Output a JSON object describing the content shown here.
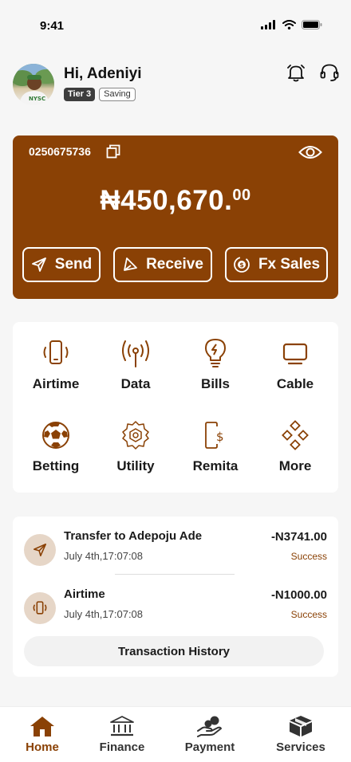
{
  "status_bar": {
    "time": "9:41"
  },
  "header": {
    "greeting": "Hi, Adeniyi",
    "tier_badge": "Tier 3",
    "account_type_badge": "Saving"
  },
  "balance_card": {
    "account_number": "0250675736",
    "balance_main": "₦450,670.",
    "balance_kobo": "00",
    "buttons": {
      "send": "Send",
      "receive": "Receive",
      "fx_sales": "Fx Sales"
    }
  },
  "services": [
    {
      "label": "Airtime",
      "icon": "phone-signal-icon"
    },
    {
      "label": "Data",
      "icon": "antenna-icon"
    },
    {
      "label": "Bills",
      "icon": "lightbulb-bolt-icon"
    },
    {
      "label": "Cable",
      "icon": "tv-icon"
    },
    {
      "label": "Betting",
      "icon": "soccer-ball-icon"
    },
    {
      "label": "Utility",
      "icon": "gear-hexagon-icon"
    },
    {
      "label": "Remita",
      "icon": "phone-dollar-icon"
    },
    {
      "label": "More",
      "icon": "diamonds-grid-icon"
    }
  ],
  "transactions": {
    "items": [
      {
        "title": "Transfer to Adepoju Ade",
        "date": "July 4th,17:07:08",
        "amount": "-N3741.00",
        "status": "Success",
        "icon": "send-arrow-icon"
      },
      {
        "title": "Airtime",
        "date": "July 4th,17:07:08",
        "amount": "-N1000.00",
        "status": "Success",
        "icon": "phone-signal-icon"
      }
    ],
    "history_button": "Transaction History"
  },
  "bottom_nav": {
    "items": [
      {
        "label": "Home",
        "icon": "house-icon",
        "active": true
      },
      {
        "label": "Finance",
        "icon": "bank-icon",
        "active": false
      },
      {
        "label": "Payment",
        "icon": "hand-coins-icon",
        "active": false
      },
      {
        "label": "Services",
        "icon": "box-icon",
        "active": false
      }
    ]
  },
  "colors": {
    "brand": "#8a4105",
    "icon_bg": "#e6d6c7",
    "background": "#f6f6f6"
  }
}
